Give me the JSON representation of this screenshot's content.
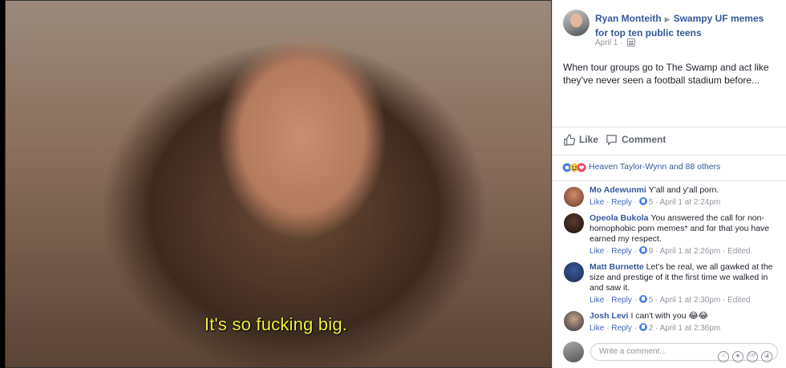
{
  "media": {
    "subtitle": "It's so fucking big.",
    "placeholder_note": "GIF frame: close-up of a woman with an open-mouthed surprised expression"
  },
  "post": {
    "author": "Ryan Monteith",
    "group": "Swampy UF memes for top ten public teens",
    "date": "April 1",
    "text": "When tour groups go to The Swamp and act like they've never seen a football stadium before..."
  },
  "actions": {
    "like": "Like",
    "comment": "Comment"
  },
  "reactions": {
    "summary": "Heaven Taylor-Wynn and 88 others"
  },
  "comments": [
    {
      "author": "Mo Adewunmi",
      "text": "Y'all and y'all porn.",
      "like": "Like",
      "reply": "Reply",
      "likes": "5",
      "time": "April 1 at 2:24pm",
      "edited": ""
    },
    {
      "author": "Opeola Bukola",
      "text": "You answered the call for non-homophobic porn memes* and for that you have earned my respect.",
      "like": "Like",
      "reply": "Reply",
      "likes": "9",
      "time": "April 1 at 2:26pm",
      "edited": "Edited"
    },
    {
      "author": "Matt Burnette",
      "text": "Let's be real, we all gawked at the size and prestige of it the first time we walked in and saw it.",
      "like": "Like",
      "reply": "Reply",
      "likes": "5",
      "time": "April 1 at 2:30pm",
      "edited": "Edited"
    },
    {
      "author": "Josh Levi",
      "text": "I can't with you 😂😂",
      "like": "Like",
      "reply": "Reply",
      "likes": "2",
      "time": "April 1 at 2:36pm",
      "edited": ""
    }
  ],
  "write_comment": {
    "placeholder": "Write a comment..."
  },
  "icons": {
    "emoji": "emoji-icon",
    "camera": "camera-icon",
    "gif": "GIF",
    "sticker": "sticker-icon"
  },
  "colors": {
    "link": "#365899",
    "subtitle": "#f3ee3a"
  }
}
